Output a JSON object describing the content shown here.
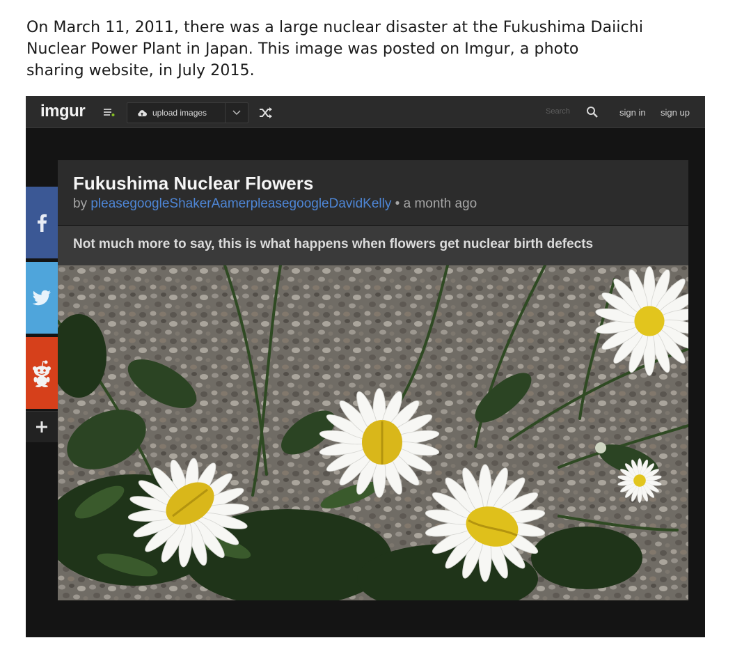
{
  "intro": {
    "line1": "On March 11, 2011, there was a large nuclear disaster at the Fukushima Daiichi",
    "line2": "Nuclear Power Plant in Japan. This image was posted on Imgur, a photo",
    "line3": "sharing website, in July 2015."
  },
  "topbar": {
    "logo": "imgur",
    "upload_label": "upload images",
    "search_label": "Search",
    "sign_in": "sign in",
    "sign_up": "sign up"
  },
  "social": {
    "facebook_icon": "facebook-icon",
    "twitter_icon": "twitter-icon",
    "reddit_icon": "reddit-icon",
    "add_icon": "plus-icon"
  },
  "post": {
    "title": "Fukushima Nuclear Flowers",
    "by": "by",
    "author": "pleasegoogleShakerAamerpleasegoogleDavidKelly",
    "separator": "•",
    "time": "a month ago",
    "description": "Not much more to say, this is what happens when flowers get nuclear birth defects"
  },
  "colors": {
    "facebook": "#3b5895",
    "twitter": "#4fa5db",
    "reddit": "#d6401b",
    "link": "#4e86d6",
    "accent_green": "#85bf25"
  }
}
